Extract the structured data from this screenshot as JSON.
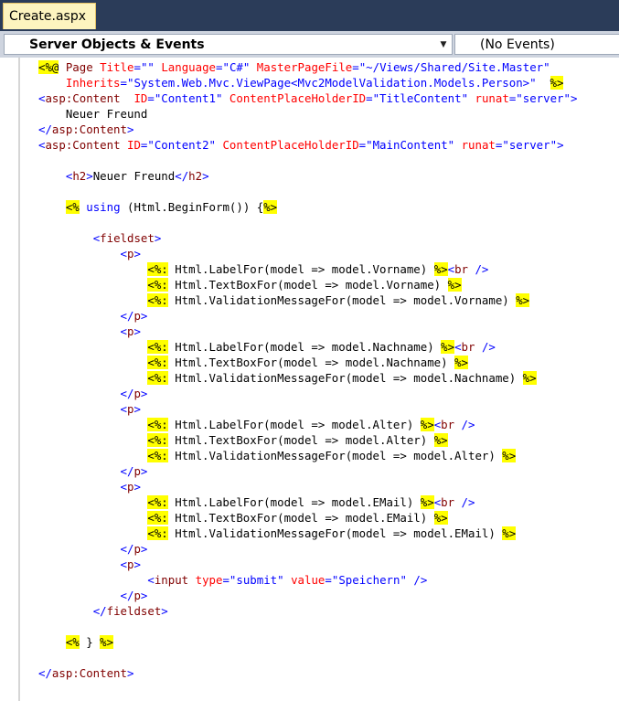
{
  "tab": {
    "title": "Create.aspx"
  },
  "navbar": {
    "objects_dropdown": "Server Objects & Events",
    "events_dropdown": "(No Events)"
  },
  "code_lines": [
    [
      [
        "d",
        "<%@"
      ],
      [
        "",
        ""
      ],
      [
        "t",
        " Page "
      ],
      [
        "a",
        "Title"
      ],
      [
        "p",
        "="
      ],
      [
        "v",
        "\"\""
      ],
      [
        "t",
        " "
      ],
      [
        "a",
        "Language"
      ],
      [
        "p",
        "="
      ],
      [
        "v",
        "\"C#\""
      ],
      [
        "t",
        " "
      ],
      [
        "a",
        "MasterPageFile"
      ],
      [
        "p",
        "="
      ],
      [
        "v",
        "\"~/Views/Shared/Site.Master\""
      ]
    ],
    [
      [
        "",
        "    "
      ],
      [
        "a",
        "Inherits"
      ],
      [
        "p",
        "="
      ],
      [
        "v",
        "\"System.Web.Mvc.ViewPage<Mvc2ModelValidation.Models.Person>\""
      ],
      [
        "",
        "  "
      ],
      [
        "d",
        "%>"
      ]
    ],
    [
      [
        "p",
        "<"
      ],
      [
        "t",
        "asp:Content"
      ],
      [
        "",
        "  "
      ],
      [
        "a",
        "ID"
      ],
      [
        "p",
        "="
      ],
      [
        "v",
        "\"Content1\""
      ],
      [
        "",
        ""
      ],
      [
        "t",
        " "
      ],
      [
        "a",
        "ContentPlaceHolderID"
      ],
      [
        "p",
        "="
      ],
      [
        "v",
        "\"TitleContent\""
      ],
      [
        "t",
        " "
      ],
      [
        "a",
        "runat"
      ],
      [
        "p",
        "="
      ],
      [
        "v",
        "\"server\""
      ],
      [
        "p",
        ">"
      ]
    ],
    [
      [
        "",
        "    Neuer Freund"
      ]
    ],
    [
      [
        "p",
        "</"
      ],
      [
        "t",
        "asp:Content"
      ],
      [
        "p",
        ">"
      ]
    ],
    [
      [
        "p",
        "<"
      ],
      [
        "t",
        "asp:Content"
      ],
      [
        "t",
        " "
      ],
      [
        "a",
        "ID"
      ],
      [
        "p",
        "="
      ],
      [
        "v",
        "\"Content2\""
      ],
      [
        "t",
        " "
      ],
      [
        "a",
        "ContentPlaceHolderID"
      ],
      [
        "p",
        "="
      ],
      [
        "v",
        "\"MainContent\""
      ],
      [
        "t",
        " "
      ],
      [
        "a",
        "runat"
      ],
      [
        "p",
        "="
      ],
      [
        "v",
        "\"server\""
      ],
      [
        "p",
        ">"
      ]
    ],
    [],
    [
      [
        "",
        "    "
      ],
      [
        "p",
        "<"
      ],
      [
        "t",
        "h2"
      ],
      [
        "p",
        ">"
      ],
      [
        "",
        "Neuer Freund"
      ],
      [
        "p",
        "</"
      ],
      [
        "t",
        "h2"
      ],
      [
        "p",
        ">"
      ]
    ],
    [],
    [
      [
        "",
        "    "
      ],
      [
        "d",
        "<%"
      ],
      [
        "",
        " "
      ],
      [
        "k",
        "using"
      ],
      [
        "",
        " (Html.BeginForm()) {"
      ],
      [
        "d",
        "%>"
      ]
    ],
    [],
    [
      [
        "",
        "        "
      ],
      [
        "p",
        "<"
      ],
      [
        "t",
        "fieldset"
      ],
      [
        "p",
        ">"
      ]
    ],
    [
      [
        "",
        "            "
      ],
      [
        "p",
        "<"
      ],
      [
        "t",
        "p"
      ],
      [
        "p",
        ">"
      ]
    ],
    [
      [
        "",
        "                "
      ],
      [
        "d",
        "<%:"
      ],
      [
        "",
        " Html.LabelFor(model => model.Vorname) "
      ],
      [
        "d",
        "%>"
      ],
      [
        "p",
        "<"
      ],
      [
        "t",
        "br"
      ],
      [
        "",
        " "
      ],
      [
        "p",
        "/>"
      ]
    ],
    [
      [
        "",
        "                "
      ],
      [
        "d",
        "<%:"
      ],
      [
        "",
        " Html.TextBoxFor(model => model.Vorname) "
      ],
      [
        "d",
        "%>"
      ]
    ],
    [
      [
        "",
        "                "
      ],
      [
        "d",
        "<%:"
      ],
      [
        "",
        " Html.ValidationMessageFor(model => model.Vorname) "
      ],
      [
        "d",
        "%>"
      ]
    ],
    [
      [
        "",
        "            "
      ],
      [
        "p",
        "</"
      ],
      [
        "t",
        "p"
      ],
      [
        "p",
        ">"
      ]
    ],
    [
      [
        "",
        "            "
      ],
      [
        "p",
        "<"
      ],
      [
        "t",
        "p"
      ],
      [
        "p",
        ">"
      ]
    ],
    [
      [
        "",
        "                "
      ],
      [
        "d",
        "<%:"
      ],
      [
        "",
        " Html.LabelFor(model => model.Nachname) "
      ],
      [
        "d",
        "%>"
      ],
      [
        "p",
        "<"
      ],
      [
        "t",
        "br"
      ],
      [
        "",
        " "
      ],
      [
        "p",
        "/>"
      ]
    ],
    [
      [
        "",
        "                "
      ],
      [
        "d",
        "<%:"
      ],
      [
        "",
        " Html.TextBoxFor(model => model.Nachname) "
      ],
      [
        "d",
        "%>"
      ]
    ],
    [
      [
        "",
        "                "
      ],
      [
        "d",
        "<%:"
      ],
      [
        "",
        " Html.ValidationMessageFor(model => model.Nachname) "
      ],
      [
        "d",
        "%>"
      ]
    ],
    [
      [
        "",
        "            "
      ],
      [
        "p",
        "</"
      ],
      [
        "t",
        "p"
      ],
      [
        "p",
        ">"
      ]
    ],
    [
      [
        "",
        "            "
      ],
      [
        "p",
        "<"
      ],
      [
        "t",
        "p"
      ],
      [
        "p",
        ">"
      ]
    ],
    [
      [
        "",
        "                "
      ],
      [
        "d",
        "<%:"
      ],
      [
        "",
        " Html.LabelFor(model => model.Alter) "
      ],
      [
        "d",
        "%>"
      ],
      [
        "p",
        "<"
      ],
      [
        "t",
        "br"
      ],
      [
        "",
        " "
      ],
      [
        "p",
        "/>"
      ]
    ],
    [
      [
        "",
        "                "
      ],
      [
        "d",
        "<%:"
      ],
      [
        "",
        " Html.TextBoxFor(model => model.Alter) "
      ],
      [
        "d",
        "%>"
      ]
    ],
    [
      [
        "",
        "                "
      ],
      [
        "d",
        "<%:"
      ],
      [
        "",
        " Html.ValidationMessageFor(model => model.Alter) "
      ],
      [
        "d",
        "%>"
      ]
    ],
    [
      [
        "",
        "            "
      ],
      [
        "p",
        "</"
      ],
      [
        "t",
        "p"
      ],
      [
        "p",
        ">"
      ]
    ],
    [
      [
        "",
        "            "
      ],
      [
        "p",
        "<"
      ],
      [
        "t",
        "p"
      ],
      [
        "p",
        ">"
      ]
    ],
    [
      [
        "",
        "                "
      ],
      [
        "d",
        "<%:"
      ],
      [
        "",
        " Html.LabelFor(model => model.EMail) "
      ],
      [
        "d",
        "%>"
      ],
      [
        "p",
        "<"
      ],
      [
        "t",
        "br"
      ],
      [
        "",
        " "
      ],
      [
        "p",
        "/>"
      ]
    ],
    [
      [
        "",
        "                "
      ],
      [
        "d",
        "<%:"
      ],
      [
        "",
        " Html.TextBoxFor(model => model.EMail) "
      ],
      [
        "d",
        "%>"
      ]
    ],
    [
      [
        "",
        "                "
      ],
      [
        "d",
        "<%:"
      ],
      [
        "",
        " Html.ValidationMessageFor(model => model.EMail) "
      ],
      [
        "d",
        "%>"
      ]
    ],
    [
      [
        "",
        "            "
      ],
      [
        "p",
        "</"
      ],
      [
        "t",
        "p"
      ],
      [
        "p",
        ">"
      ]
    ],
    [
      [
        "",
        "            "
      ],
      [
        "p",
        "<"
      ],
      [
        "t",
        "p"
      ],
      [
        "p",
        ">"
      ]
    ],
    [
      [
        "",
        "                "
      ],
      [
        "p",
        "<"
      ],
      [
        "t",
        "input"
      ],
      [
        "t",
        " "
      ],
      [
        "a",
        "type"
      ],
      [
        "p",
        "="
      ],
      [
        "v",
        "\"submit\""
      ],
      [
        "t",
        " "
      ],
      [
        "a",
        "value"
      ],
      [
        "p",
        "="
      ],
      [
        "v",
        "\"Speichern\""
      ],
      [
        "",
        " "
      ],
      [
        "p",
        "/>"
      ]
    ],
    [
      [
        "",
        "            "
      ],
      [
        "p",
        "</"
      ],
      [
        "t",
        "p"
      ],
      [
        "p",
        ">"
      ]
    ],
    [
      [
        "",
        "        "
      ],
      [
        "p",
        "</"
      ],
      [
        "t",
        "fieldset"
      ],
      [
        "p",
        ">"
      ]
    ],
    [],
    [
      [
        "",
        "    "
      ],
      [
        "d",
        "<%"
      ],
      [
        "",
        " } "
      ],
      [
        "d",
        "%>"
      ]
    ],
    [],
    [
      [
        "p",
        "</"
      ],
      [
        "t",
        "asp:Content"
      ],
      [
        "p",
        ">"
      ]
    ]
  ]
}
